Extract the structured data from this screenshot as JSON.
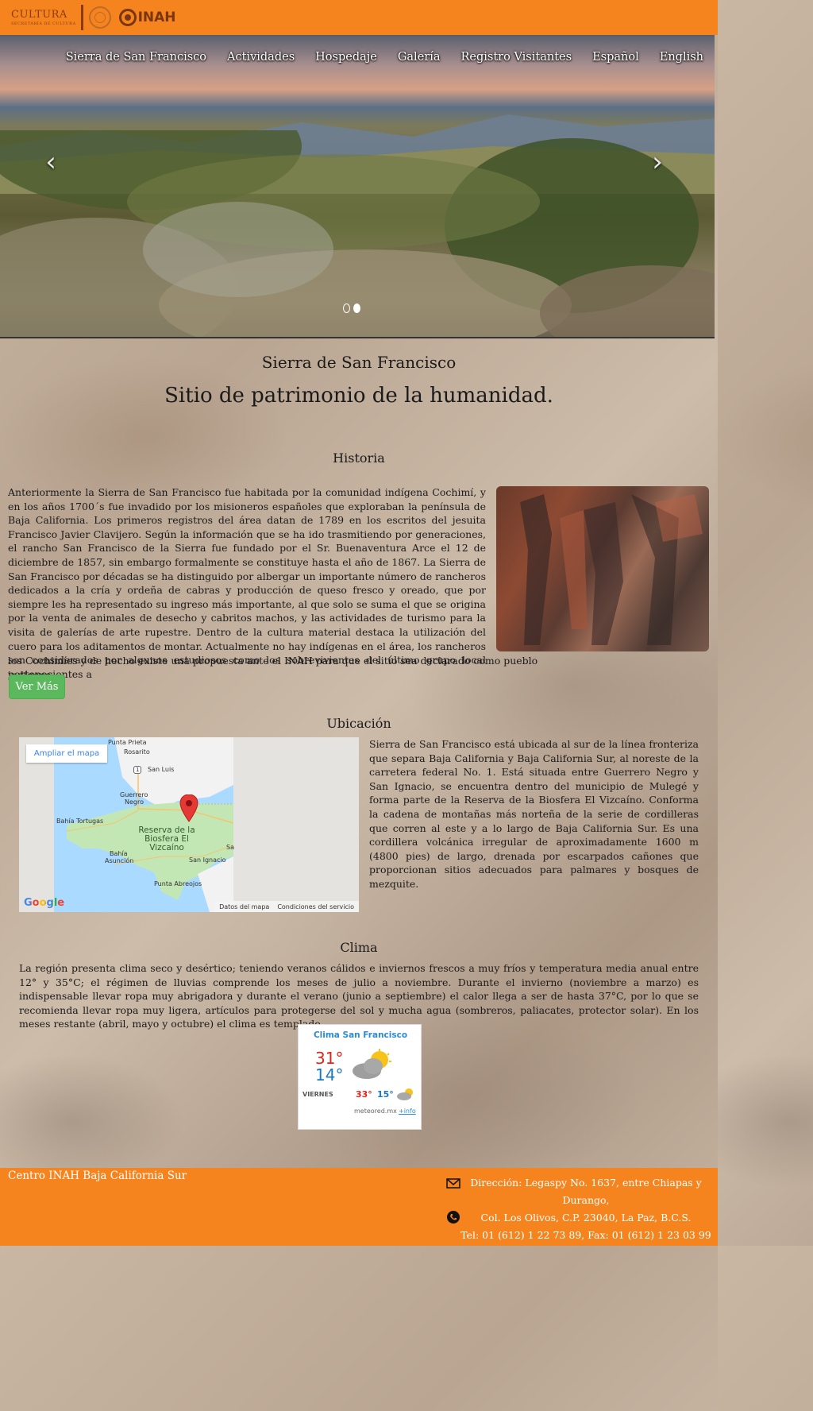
{
  "header": {
    "logo_cultura": "CULTURA",
    "logo_cultura_sub": "SECRETARÍA DE CULTURA",
    "logo_inah": "INAH"
  },
  "nav": {
    "items": [
      "Sierra de San Francisco",
      "Actividades",
      "Hospedaje",
      "Galería",
      "Registro Visitantes",
      "Español",
      "English"
    ]
  },
  "carousel": {
    "prev_glyph": "‹",
    "next_glyph": "›",
    "slides": 2,
    "active_slide": 2
  },
  "main": {
    "title": "Sierra de San Francisco",
    "subtitle": "Sitio de patrimonio de la humanidad."
  },
  "historia": {
    "title": "Historia",
    "text": "Anteriormente la Sierra de San Francisco fue habitada por la comunidad indígena Cochimí, y en los años 1700´s fue invadido por los misioneros españoles que exploraban la península de Baja California. Los primeros registros del área datan de 1789 en los escritos del jesuita Francisco Javier Clavijero. Según la información que se ha ido trasmitiendo por generaciones, el rancho San Francisco de la Sierra fue fundado por el Sr. Buenaventura Arce el 12 de diciembre de 1857, sin embargo formalmente se constituye hasta el año de 1867. La Sierra de San Francisco por décadas se ha distinguido por albergar un importante número de rancheros dedicados a la cría y ordeña de cabras y producción de queso fresco y oreado, que por siempre les ha representado su ingreso más importante, al que solo se suma el que se origina por la venta de animales de desecho y cabritos machos, y las actividades de turismo para la visita de galerías de arte rupestre. Dentro de la cultura material destaca la utilización del cuero para los aditamentos de montar. Actualmente no hay indígenas en el área, los rancheros son considerados por algunos estudiosos como los sobrevivientes del último grupo local pertenecientes a",
    "text_last": "los Cochimíes y de hecho existe una propuesta ante el INAH para que el sitio sea declarado como pueblo indígena.",
    "button": "Ver Más"
  },
  "ubicacion": {
    "title": "Ubicación",
    "text": "Sierra de San Francisco está ubicada al sur de la línea fronteriza que separa Baja California y Baja California Sur, al noreste de la carretera federal No. 1. Está situada entre Guerrero Negro y San Ignacio, se encuentra dentro del municipio de Mulegé y forma parte de la Reserva de la Biosfera El Vizcaíno. Conforma la cadena de montañas más norteña de la serie de cordilleras que corren al este y a lo largo de Baja California Sur. Es una cordillera volcánica irregular de aproximadamente 1600 m (4800 pies) de largo, drenada por escarpados cañones que proporcionan sitios adecuados para palmares y bosques de mezquite.",
    "map": {
      "expand": "Ampliar el mapa",
      "labels": {
        "punta_prieta": "Punta Prieta",
        "rosarito": "Rosarito",
        "san_luis": "San Luis",
        "guerrero": "Guerrero",
        "negro": "Negro",
        "bahia_tortugas": "Bahía Tortugas",
        "reserva": "Reserva de la Biosfera El Vizcaíno",
        "bahia": "Bahía",
        "asuncion": "Asunción",
        "san_ignacio": "San Ignacio",
        "punta_abreojos": "Punta Abreojos",
        "sa": "Sa",
        "route": "1"
      },
      "data_link": "Datos del mapa",
      "terms_link": "Condiciones del servicio",
      "google": "Google"
    }
  },
  "clima": {
    "title": "Clima",
    "text": "La región presenta clima seco y desértico; teniendo veranos cálidos e inviernos frescos a muy fríos y temperatura media anual entre 12° y 35°C; el régimen de lluvias comprende los meses de julio a noviembre. Durante el invierno (noviembre a marzo) es indispensable llevar ropa muy abrigadora y durante el verano (junio a septiembre) el calor llega a ser de hasta 37°C, por lo que se recomienda llevar ropa muy ligera, artículos para protegerse del sol y mucha agua (sombreros, paliacates, protector solar). En los meses restante (abril, mayo y octubre) el clima es templado.",
    "widget": {
      "title": "Clima San Francisco",
      "max": "31°",
      "min": "14°",
      "day": "VIERNES",
      "day_max": "33°",
      "day_min": "15°",
      "source": "meteored.mx",
      "info": "+info"
    }
  },
  "footer": {
    "name": "Centro INAH Baja California Sur",
    "address1": "Dirección: Legaspy No. 1637, entre Chiapas y Durango,",
    "address2": "Col. Los Olivos, C.P. 23040, La Paz, B.C.S.",
    "phone": "Tel: 01 (612) 1 22 73 89, Fax: 01 (612) 1 23 03 99"
  },
  "colors": {
    "brand_orange": "#f5841f",
    "button_green": "#5cb85c",
    "link_blue": "#2c8bd1",
    "temp_max": "#e5231b",
    "temp_min": "#1c77c7"
  },
  "icons": [
    "chevron-left-icon",
    "chevron-right-icon",
    "map-pin-icon",
    "cloud-sun-icon",
    "mail-icon",
    "phone-icon"
  ]
}
